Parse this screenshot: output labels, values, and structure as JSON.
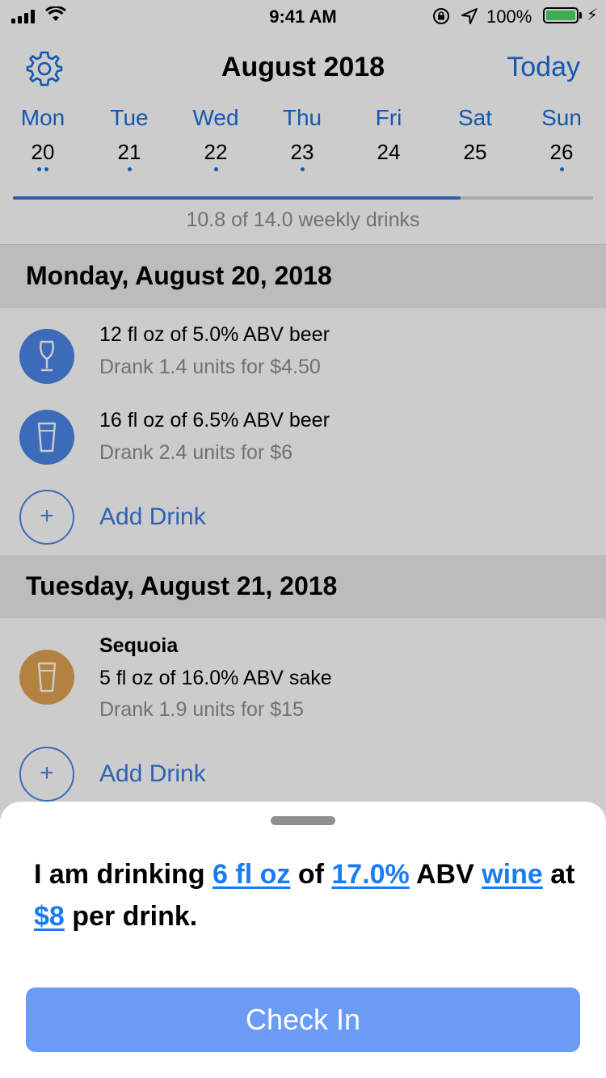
{
  "status_bar": {
    "time": "9:41 AM",
    "battery_percent": "100%",
    "battery_level": 1.0
  },
  "header": {
    "month_title": "August 2018",
    "today_label": "Today",
    "settings_icon": "gear-icon"
  },
  "week": {
    "days": [
      {
        "name": "Mon",
        "date": "20",
        "dots": 2
      },
      {
        "name": "Tue",
        "date": "21",
        "dots": 1
      },
      {
        "name": "Wed",
        "date": "22",
        "dots": 1
      },
      {
        "name": "Thu",
        "date": "23",
        "dots": 1
      },
      {
        "name": "Fri",
        "date": "24",
        "dots": 0
      },
      {
        "name": "Sat",
        "date": "25",
        "dots": 0
      },
      {
        "name": "Sun",
        "date": "26",
        "dots": 1
      }
    ],
    "progress_fraction": 0.7714,
    "weekly_summary": "10.8 of 14.0 weekly drinks"
  },
  "sections": [
    {
      "title": "Monday, August 20, 2018",
      "entries": [
        {
          "icon": "tulip-glass-icon",
          "color": "#4a86e8",
          "line1": "12 fl oz of 5.0% ABV beer",
          "line2": "Drank 1.4 units for $4.50"
        },
        {
          "icon": "pint-glass-icon",
          "color": "#4a86e8",
          "line1": "16 fl oz of 6.5% ABV beer",
          "line2": "Drank 2.4 units for $6"
        }
      ],
      "add_label": "Add Drink"
    },
    {
      "title": "Tuesday, August 21, 2018",
      "entries": [
        {
          "icon": "pint-glass-icon",
          "color": "#e0a350",
          "name": "Sequoia",
          "line1": "5 fl oz of 16.0% ABV sake",
          "line2": "Drank 1.9 units for $15"
        }
      ],
      "add_label": "Add Drink"
    }
  ],
  "sheet": {
    "t1": "I am drinking ",
    "amount": "6 fl oz",
    "t2": " of ",
    "abv": "17.0%",
    "t3": " ABV ",
    "drink_type": "wine",
    "t4": " at ",
    "price": "$8",
    "t5": " per drink.",
    "checkin_label": "Check In"
  },
  "colors": {
    "accent": "#1a6fe0",
    "beer_icon": "#4a86e8",
    "sake_icon": "#e0a350",
    "checkin_button": "#6a9cf6",
    "progress": "#3f74d8"
  }
}
